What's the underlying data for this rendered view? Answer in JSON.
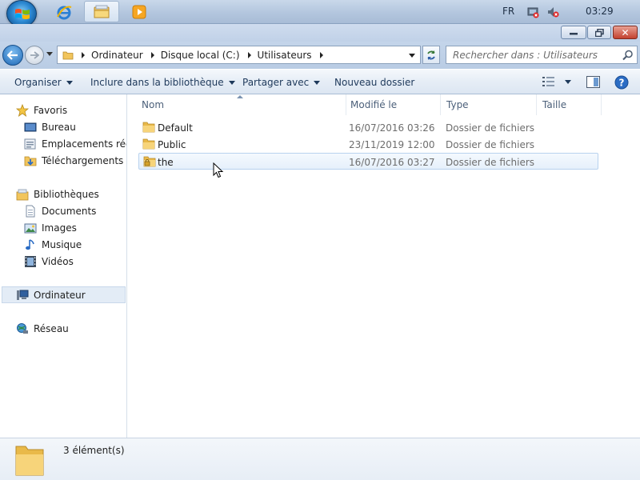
{
  "taskbar": {
    "language": "FR",
    "clock": "03:29",
    "pinned": [
      {
        "name": "internet-explorer",
        "active": false
      },
      {
        "name": "windows-explorer",
        "active": true
      },
      {
        "name": "media-player",
        "active": false
      }
    ]
  },
  "address": {
    "crumbs": [
      "Ordinateur",
      "Disque local (C:)",
      "Utilisateurs"
    ]
  },
  "search": {
    "placeholder": "Rechercher dans : Utilisateurs"
  },
  "toolbar": {
    "organize": "Organiser",
    "include": "Inclure dans la bibliothèque",
    "share": "Partager avec",
    "new_folder": "Nouveau dossier"
  },
  "sidebar": {
    "favorites": "Favoris",
    "desktop": "Bureau",
    "recent": "Emplacements récents",
    "downloads": "Téléchargements",
    "libraries": "Bibliothèques",
    "documents": "Documents",
    "images": "Images",
    "music": "Musique",
    "videos": "Vidéos",
    "computer": "Ordinateur",
    "network": "Réseau"
  },
  "columns": {
    "name": "Nom",
    "modified": "Modifié le",
    "type": "Type",
    "size": "Taille"
  },
  "files": [
    {
      "name": "Default",
      "modified": "16/07/2016 03:26",
      "type": "Dossier de fichiers",
      "size": "",
      "locked": false
    },
    {
      "name": "Public",
      "modified": "23/11/2019 12:00",
      "type": "Dossier de fichiers",
      "size": "",
      "locked": false
    },
    {
      "name": "the",
      "modified": "16/07/2016 03:27",
      "type": "Dossier de fichiers",
      "size": "",
      "locked": true
    }
  ],
  "status": {
    "item_count": "3 élément(s)"
  },
  "colors": {
    "accent": "#1e395b",
    "folder": "#f2c55c",
    "hover": "#e6f0fb"
  }
}
